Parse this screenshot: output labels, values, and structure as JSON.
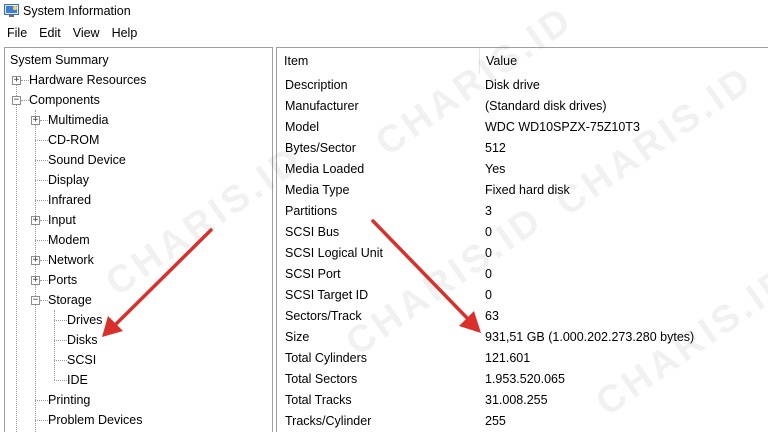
{
  "window": {
    "title": "System Information",
    "icon": "system-information-icon"
  },
  "menu": {
    "items": [
      "File",
      "Edit",
      "View",
      "Help"
    ]
  },
  "tree": {
    "items": [
      {
        "label": "System Summary",
        "expander": ""
      },
      {
        "label": "Hardware Resources",
        "expander": "+"
      },
      {
        "label": "Components",
        "expander": "−"
      },
      {
        "label": "Multimedia",
        "expander": "+"
      },
      {
        "label": "CD-ROM",
        "expander": ""
      },
      {
        "label": "Sound Device",
        "expander": ""
      },
      {
        "label": "Display",
        "expander": ""
      },
      {
        "label": "Infrared",
        "expander": ""
      },
      {
        "label": "Input",
        "expander": "+"
      },
      {
        "label": "Modem",
        "expander": ""
      },
      {
        "label": "Network",
        "expander": "+"
      },
      {
        "label": "Ports",
        "expander": "+"
      },
      {
        "label": "Storage",
        "expander": "−"
      },
      {
        "label": "Drives",
        "expander": ""
      },
      {
        "label": "Disks",
        "expander": ""
      },
      {
        "label": "SCSI",
        "expander": ""
      },
      {
        "label": "IDE",
        "expander": ""
      },
      {
        "label": "Printing",
        "expander": ""
      },
      {
        "label": "Problem Devices",
        "expander": ""
      }
    ]
  },
  "details": {
    "columns": [
      "Item",
      "Value"
    ],
    "rows": [
      [
        "Description",
        "Disk drive"
      ],
      [
        "Manufacturer",
        "(Standard disk drives)"
      ],
      [
        "Model",
        "WDC WD10SPZX-75Z10T3"
      ],
      [
        "Bytes/Sector",
        "512"
      ],
      [
        "Media Loaded",
        "Yes"
      ],
      [
        "Media Type",
        "Fixed hard disk"
      ],
      [
        "Partitions",
        "3"
      ],
      [
        "SCSI Bus",
        "0"
      ],
      [
        "SCSI Logical Unit",
        "0"
      ],
      [
        "SCSI Port",
        "0"
      ],
      [
        "SCSI Target ID",
        "0"
      ],
      [
        "Sectors/Track",
        "63"
      ],
      [
        "Size",
        "931,51 GB (1.000.202.273.280 bytes)"
      ],
      [
        "Total Cylinders",
        "121.601"
      ],
      [
        "Total Sectors",
        "1.953.520.065"
      ],
      [
        "Total Tracks",
        "31.008.255"
      ],
      [
        "Tracks/Cylinder",
        "255"
      ]
    ]
  },
  "watermark": {
    "text": "CHARIS.ID"
  },
  "annotation": {
    "arrow_color": "#d9302c"
  }
}
